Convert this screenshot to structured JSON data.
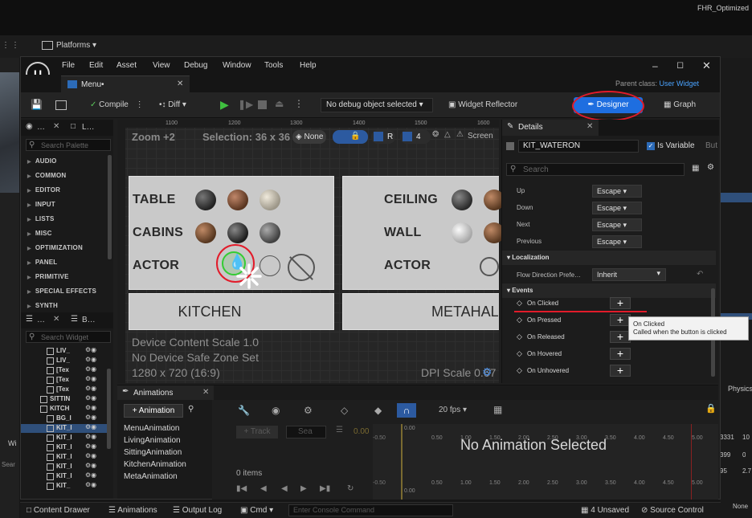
{
  "bg": {
    "top_right_title": "FHR_Optimized",
    "platforms_label": "Platforms",
    "right_partial": [
      "Physics"
    ],
    "right_numbers": [
      "3331",
      "10",
      "399",
      "0",
      "95",
      "2.7"
    ],
    "left_partial": [
      "Wi",
      "Sear"
    ],
    "bottom_right": "None"
  },
  "window": {
    "menu": [
      "File",
      "Edit",
      "Asset",
      "View",
      "Debug",
      "Window",
      "Tools",
      "Help"
    ],
    "tab_title": "Menu•",
    "parent_class_label": "Parent class:",
    "parent_class_value": "User Widget"
  },
  "toolbar": {
    "compile": "Compile",
    "diff": "Diff",
    "debug_object": "No debug object selected",
    "widget_reflector": "Widget Reflector",
    "designer": "Designer",
    "graph": "Graph"
  },
  "palette": {
    "tab1": "…",
    "tab2": "L…",
    "search_placeholder": "Search Palette",
    "categories": [
      "AUDIO",
      "COMMON",
      "EDITOR",
      "INPUT",
      "LISTS",
      "MISC",
      "OPTIMIZATION",
      "PANEL",
      "PRIMITIVE",
      "SPECIAL EFFECTS",
      "SYNTH"
    ]
  },
  "hierarchy": {
    "tab1": "…",
    "tab2": "B…",
    "search_placeholder": "Search Widget",
    "items": [
      "LIV_",
      "LIV_",
      "[Tex",
      "[Tex",
      "[Tex",
      "SITTIN",
      "KITCH",
      "BG_I",
      "KIT_I",
      "KIT_I",
      "KIT_I",
      "KIT_I",
      "KIT_I",
      "KIT_I",
      "KIT_"
    ]
  },
  "canvas": {
    "ruler": [
      "1100",
      "1200",
      "1300",
      "1400",
      "1500",
      "1600"
    ],
    "zoom": "Zoom +2",
    "selection": "Selection: 36 x 36",
    "none_label": "None",
    "r_label": "R",
    "grid_value": "4",
    "screen_label": "Screen",
    "left_labels": [
      "TABLE",
      "CABINS",
      "ACTOR"
    ],
    "right_labels": [
      "CEILING",
      "WALL",
      "ACTOR"
    ],
    "kitchen": "KITCHEN",
    "metahal": "METAHAL",
    "device_scale": "Device Content Scale 1.0",
    "no_safe_zone": "No Device Safe Zone Set",
    "resolution": "1280 x 720 (16:9)",
    "dpi_scale": "DPI Scale 0.67"
  },
  "details": {
    "title": "Details",
    "widget_name": "KIT_WATERON",
    "is_variable": "Is Variable",
    "but_partial": "But",
    "search_placeholder": "Search",
    "nav": [
      {
        "label": "Up",
        "value": "Escape"
      },
      {
        "label": "Down",
        "value": "Escape"
      },
      {
        "label": "Next",
        "value": "Escape"
      },
      {
        "label": "Previous",
        "value": "Escape"
      }
    ],
    "localization": "Localization",
    "flow_label": "Flow Direction Prefe…",
    "flow_value": "Inherit",
    "events": "Events",
    "event_items": [
      "On Clicked",
      "On Pressed",
      "On Released",
      "On Hovered",
      "On Unhovered"
    ],
    "tooltip_title": "On Clicked",
    "tooltip_text": "Called when the button is clicked"
  },
  "animations": {
    "title": "Animations",
    "add_button": "+ Animation",
    "list": [
      "MenuAnimation",
      "LivingAnimation",
      "SittingAnimation",
      "KitchenAnimation",
      "MetaAnimation"
    ],
    "track": "+ Track",
    "search_placeholder": "Sea",
    "time_value": "0.00",
    "fps": "20 fps",
    "items_count": "0 items",
    "empty": "No Animation Selected",
    "timeline_ticks": [
      "0.00",
      "0.50",
      "1.00",
      "1.50",
      "2.00",
      "2.50",
      "3.00",
      "3.50",
      "4.00",
      "4.50",
      "5.00"
    ],
    "neg": "-0.50"
  },
  "status": {
    "content_drawer": "Content Drawer",
    "animations": "Animations",
    "output_log": "Output Log",
    "cmd": "Cmd",
    "console_placeholder": "Enter Console Command",
    "unsaved": "4 Unsaved",
    "source_control": "Source Control"
  }
}
